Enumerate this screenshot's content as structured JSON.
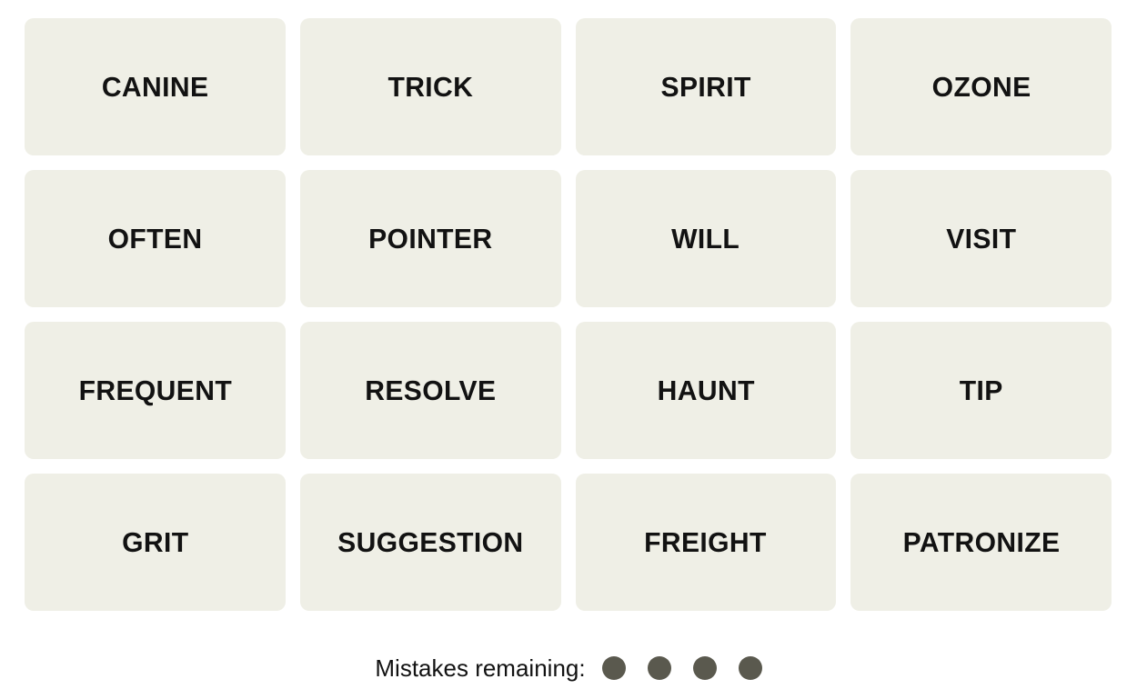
{
  "game": {
    "name": "Connections word puzzle",
    "background_color": "#ffffff"
  },
  "grid": {
    "columns": 4,
    "rows": 4,
    "tile_color": "#efefe6",
    "tile_text_color": "#121212",
    "tiles": [
      {
        "word": "CANINE"
      },
      {
        "word": "TRICK"
      },
      {
        "word": "SPIRIT"
      },
      {
        "word": "OZONE"
      },
      {
        "word": "OFTEN"
      },
      {
        "word": "POINTER"
      },
      {
        "word": "WILL"
      },
      {
        "word": "VISIT"
      },
      {
        "word": "FREQUENT"
      },
      {
        "word": "RESOLVE"
      },
      {
        "word": "HAUNT"
      },
      {
        "word": "TIP"
      },
      {
        "word": "GRIT"
      },
      {
        "word": "SUGGESTION"
      },
      {
        "word": "FREIGHT"
      },
      {
        "word": "PATRONIZE"
      }
    ]
  },
  "mistakes": {
    "label": "Mistakes remaining:",
    "remaining": 4,
    "dot_color": "#5a594e",
    "dots": [
      {
        "state": "remaining"
      },
      {
        "state": "remaining"
      },
      {
        "state": "remaining"
      },
      {
        "state": "remaining"
      }
    ]
  }
}
